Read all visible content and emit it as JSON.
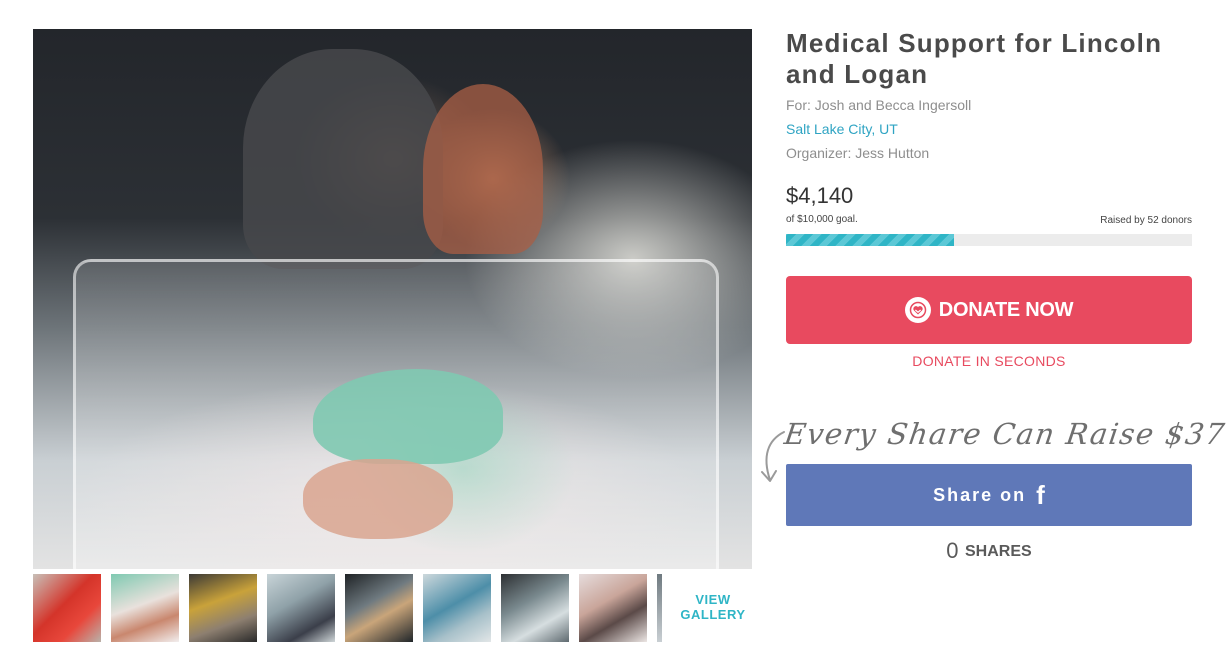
{
  "campaign": {
    "title": "Medical Support for Lincoln and Logan",
    "for_line": "For: Josh and Becca Ingersoll",
    "location": "Salt Lake City, UT",
    "organizer": "Organizer: Jess Hutton"
  },
  "funding": {
    "raised": "$4,140",
    "goal_text": "of $10,000 goal.",
    "donors_text": "Raised by 52 donors",
    "progress_fraction": 0.414
  },
  "donate": {
    "button_label": "DONATE NOW",
    "icon": "heart-circle-icon",
    "subtext": "DONATE IN SECONDS"
  },
  "share": {
    "tagline": "Every Share Can Raise $37",
    "button_label": "Share on",
    "icon": "facebook-icon",
    "count": "0",
    "count_label": "SHARES"
  },
  "gallery": {
    "view_label_line1": "VIEW",
    "view_label_line2": "GALLERY"
  },
  "colors": {
    "accent_teal": "#2fb5c6",
    "donate_red": "#e84a5f",
    "facebook_blue": "#5f78b8",
    "title_gray": "#4a4a4a"
  }
}
